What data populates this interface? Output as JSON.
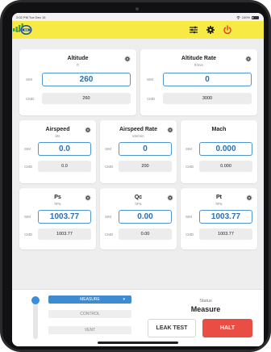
{
  "status_bar": {
    "time": "2:02 PM  Tue Dec 15",
    "battery": "100%"
  },
  "header": {
    "logo_icon": "company-logo",
    "settings_icon": "sliders-icon",
    "gear_icon": "gear-icon",
    "power_icon": "power-icon",
    "wifi_icon": "wifi-icon",
    "wifi_label": "Wifi",
    "colors": {
      "background": "#f7ea45",
      "power": "#e23b2e",
      "wifi": "#3aa84a"
    }
  },
  "labels": {
    "sim": "SIM",
    "cmd": "CMD"
  },
  "cards": {
    "altitude": {
      "title": "Altitude",
      "unit": "ft",
      "sim": "260",
      "cmd": "260"
    },
    "altitude_rate": {
      "title": "Altitude Rate",
      "unit": "ft/min",
      "sim": "0",
      "cmd": "3000"
    },
    "airspeed": {
      "title": "Airspeed",
      "unit": "kts",
      "sim": "0.0",
      "cmd": "0.0"
    },
    "airspeed_rate": {
      "title": "Airspeed Rate",
      "unit": "kts/min",
      "sim": "0",
      "cmd": "200"
    },
    "mach": {
      "title": "Mach",
      "unit": "",
      "sim": "0.000",
      "cmd": "0.000"
    },
    "ps": {
      "title": "Ps",
      "unit": "hPa",
      "sim": "1003.77",
      "cmd": "1003.77"
    },
    "qc": {
      "title": "Qc",
      "unit": "hPa",
      "sim": "0.00",
      "cmd": "0.00"
    },
    "pt": {
      "title": "Pt",
      "unit": "hPa",
      "sim": "1003.77",
      "cmd": "1003.77"
    }
  },
  "controls": {
    "modes": [
      "MEASURE",
      "CONTROL",
      "VENT"
    ],
    "selected_mode": "MEASURE",
    "status_label": "Status",
    "status_value": "Measure",
    "leak_test": "LEAK TEST",
    "halt": "HALT",
    "colors": {
      "accent": "#3f8bd0",
      "halt": "#e94d43"
    }
  }
}
